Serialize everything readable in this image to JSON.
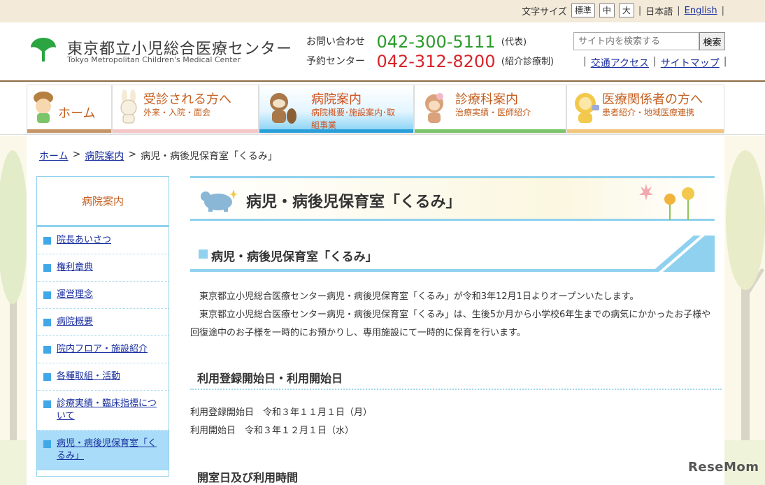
{
  "topbar": {
    "font_size_label": "文字サイズ",
    "sizes": [
      "標準",
      "中",
      "大"
    ],
    "lang_ja": "日本語",
    "lang_en": "English",
    "sep": "|"
  },
  "header": {
    "logo_jp": "東京都立小児総合医療センター",
    "logo_en": "Tokyo Metropolitan Children's Medical Center",
    "contact1_label": "お問い合わせ",
    "contact1_number": "042-300-5111",
    "contact1_note": "(代表)",
    "contact2_label": "予約センター",
    "contact2_number": "042-312-8200",
    "contact2_note": "(紹介診療制)",
    "search_placeholder": "サイト内を検索する",
    "search_button": "検索",
    "link_access": "交通アクセス",
    "link_sitemap": "サイトマップ"
  },
  "nav": {
    "items": [
      {
        "title": "ホーム",
        "sub": ""
      },
      {
        "title": "受診される方へ",
        "sub": "外来・入院・面会"
      },
      {
        "title": "病院案内",
        "sub": "病院概要･施設案内･取組事業"
      },
      {
        "title": "診療科案内",
        "sub": "治療実績・医師紹介"
      },
      {
        "title": "医療関係者の方へ",
        "sub": "患者紹介・地域医療連携"
      }
    ],
    "colors": [
      "#c4966a",
      "#f5c6c6",
      "#2b9fd9",
      "#7cc46a",
      "#f2c67a"
    ]
  },
  "breadcrumb": {
    "home": "ホーム",
    "sep": ">",
    "parent": "病院案内",
    "current": "病児・病後児保育室「くるみ」"
  },
  "sidebar": {
    "heading": "病院案内",
    "items": [
      "院長あいさつ",
      "権利章典",
      "運営理念",
      "病院概要",
      "院内フロア・施設紹介",
      "各種取組・活動",
      "診療実績・臨床指標について",
      "病児・病後児保育室「くるみ」"
    ]
  },
  "content": {
    "page_title": "病児・病後児保育室「くるみ」",
    "section_title": "病児・病後児保育室「くるみ」",
    "para1": "東京都立小児総合医療センター病児・病後児保育室「くるみ」が令和3年12月1日よりオープンいたします。",
    "para2": "東京都立小児総合医療センター病児・病後児保育室「くるみ」は、生後5か月から小学校6年生までの病気にかかったお子様や回復途中のお子様を一時的にお預かりし、専用施設にて一時的に保育を行います。",
    "sub1": "利用登録開始日・利用開始日",
    "date1": "利用登録開始日　令和３年１１月１日（月）",
    "date2": "利用開始日　令和３年１２月１日（水）",
    "sub2": "開室日及び利用時間"
  },
  "watermark": "ReseMom"
}
